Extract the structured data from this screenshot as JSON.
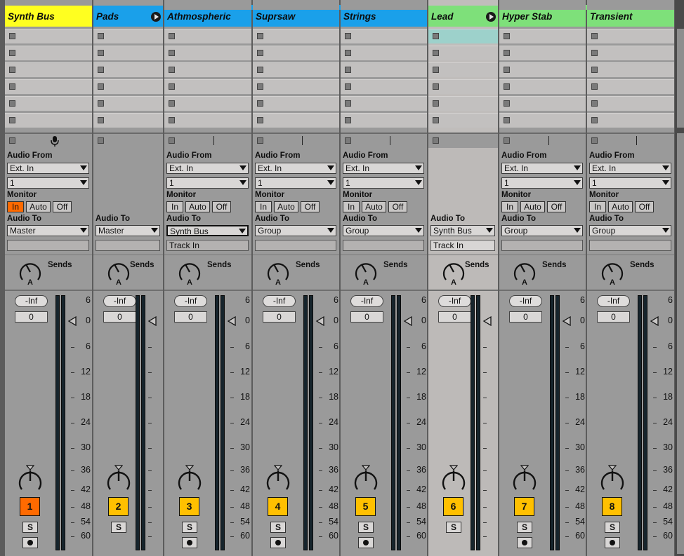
{
  "tracks": [
    {
      "name": "Synth Bus",
      "color": "#ffff20",
      "number": "1",
      "type": "audio",
      "group": false,
      "audio_from": "Ext. In",
      "audio_from_channel": "1",
      "monitor": "In",
      "audio_to": "Master",
      "has_track_in": false
    },
    {
      "name": "Pads",
      "color": "#1aa0ea",
      "number": "2",
      "type": "group",
      "group": true,
      "audio_to": "Master"
    },
    {
      "name": "Athmospheric",
      "color": "#1aa0ea",
      "number": "3",
      "type": "audio",
      "group": false,
      "audio_from": "Ext. In",
      "audio_from_channel": "1",
      "monitor": "Off",
      "audio_to": "Synth Bus",
      "audio_to_focused": true,
      "has_track_in": true,
      "track_in": "Track In"
    },
    {
      "name": "Suprsaw",
      "color": "#1aa0ea",
      "number": "4",
      "type": "audio",
      "group": false,
      "audio_from": "Ext. In",
      "audio_from_channel": "1",
      "monitor": "Off",
      "audio_to": "Group",
      "has_track_in": false
    },
    {
      "name": "Strings",
      "color": "#1aa0ea",
      "number": "5",
      "type": "audio",
      "group": false,
      "audio_from": "Ext. In",
      "audio_from_channel": "1",
      "monitor": "Off",
      "audio_to": "Group",
      "has_track_in": false
    },
    {
      "name": "Lead",
      "color": "#7ee07a",
      "number": "6",
      "type": "group",
      "group": true,
      "audio_to": "Synth Bus",
      "has_track_in": true,
      "track_in": "Track In",
      "selected": true
    },
    {
      "name": "Hyper Stab",
      "color": "#7ee07a",
      "number": "7",
      "type": "audio",
      "group": false,
      "audio_from": "Ext. In",
      "audio_from_channel": "1",
      "monitor": "Off",
      "audio_to": "Group",
      "has_track_in": false
    },
    {
      "name": "Transient",
      "color": "#7ee07a",
      "number": "8",
      "type": "audio",
      "group": false,
      "audio_from": "Ext. In",
      "audio_from_channel": "1",
      "monitor": "Off",
      "audio_to": "Group",
      "has_track_in": false
    }
  ],
  "labels": {
    "audio_from": "Audio From",
    "monitor": "Monitor",
    "audio_to": "Audio To",
    "sends": "Sends",
    "monitor_options": [
      "In",
      "Auto",
      "Off"
    ],
    "volume": "-Inf",
    "pan": "0",
    "solo": "S",
    "send_letter": "A"
  },
  "meter_scale": [
    "6",
    "0",
    "6",
    "12",
    "18",
    "24",
    "30",
    "36",
    "42",
    "48",
    "54",
    "60"
  ],
  "colors": {
    "monitor_on": "#ff6a00",
    "track_number": "#ffc000",
    "track_number_active": "#ff6a00",
    "selected_strip": "#c0bdbb",
    "clip_highlight": "#9dd1cb"
  },
  "icons": {
    "monitor_arrow": "triangle-left-icon",
    "group_fold": "play-circle-icon",
    "input": "microphone-icon",
    "arm": "record-dot-icon"
  }
}
